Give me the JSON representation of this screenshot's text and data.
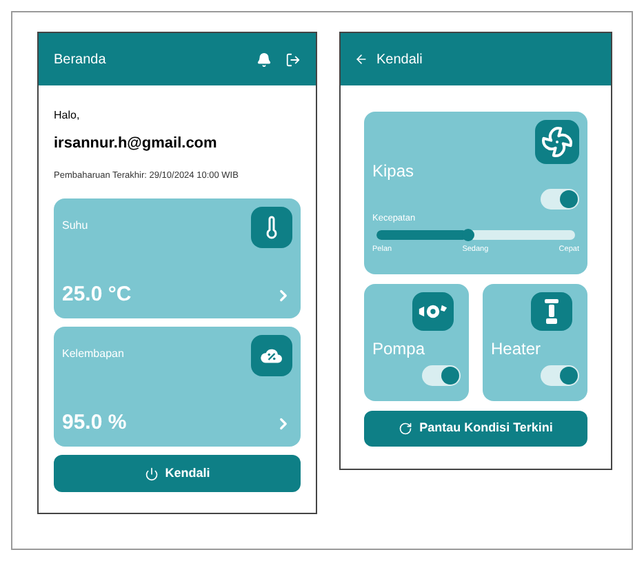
{
  "home": {
    "title": "Beranda",
    "greeting": "Halo,",
    "email": "irsannur.h@gmail.com",
    "last_update": "Pembaharuan Terakhir: 29/10/2024 10:00 WIB",
    "sensors": [
      {
        "kind": "temperature",
        "label": "Suhu",
        "value": "25.0 °C"
      },
      {
        "kind": "humidity",
        "label": "Kelembapan",
        "value": "95.0 %"
      }
    ],
    "button": "Kendali"
  },
  "control": {
    "title": "Kendali",
    "devices": [
      {
        "kind": "fan",
        "name": "Kipas",
        "on": true,
        "speed": {
          "label": "Kecepatan",
          "level": 0.46,
          "ticks": [
            "Pelan",
            "Sedang",
            "Cepat"
          ]
        }
      },
      {
        "kind": "pump",
        "name": "Pompa",
        "on": true
      },
      {
        "kind": "heater",
        "name": "Heater",
        "on": true
      }
    ],
    "button": "Pantau Kondisi Terkini"
  }
}
